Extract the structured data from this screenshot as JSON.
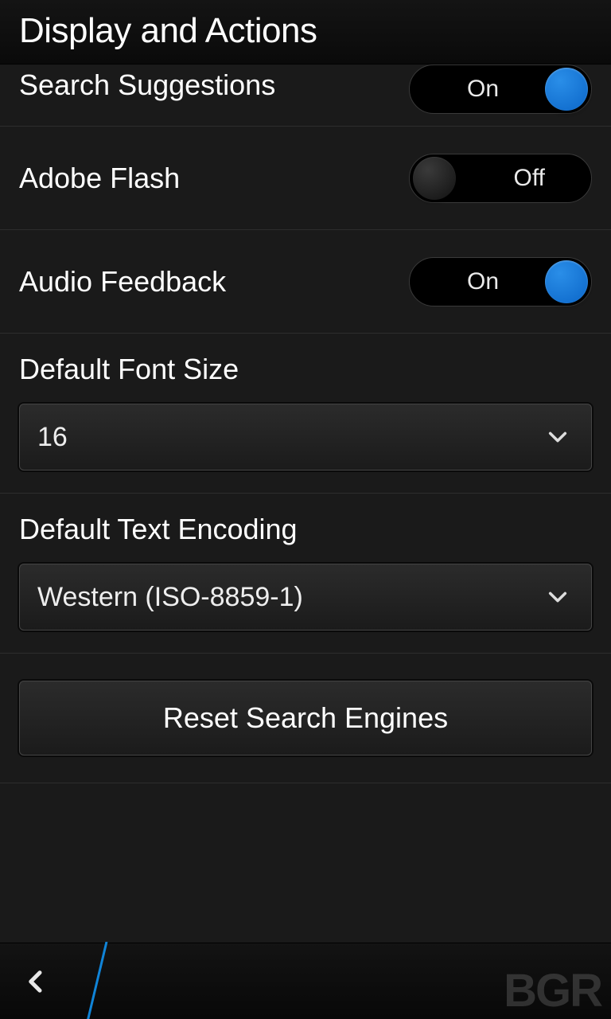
{
  "header": {
    "title": "Display and Actions"
  },
  "settings": {
    "searchSuggestions": {
      "label": "Search Suggestions",
      "state": "On"
    },
    "adobeFlash": {
      "label": "Adobe Flash",
      "state": "Off"
    },
    "audioFeedback": {
      "label": "Audio Feedback",
      "state": "On"
    },
    "defaultFontSize": {
      "label": "Default Font Size",
      "value": "16"
    },
    "defaultTextEncoding": {
      "label": "Default Text Encoding",
      "value": "Western (ISO-8859-1)"
    },
    "resetSearchEngines": {
      "label": "Reset Search Engines"
    }
  },
  "watermark": "BGR"
}
